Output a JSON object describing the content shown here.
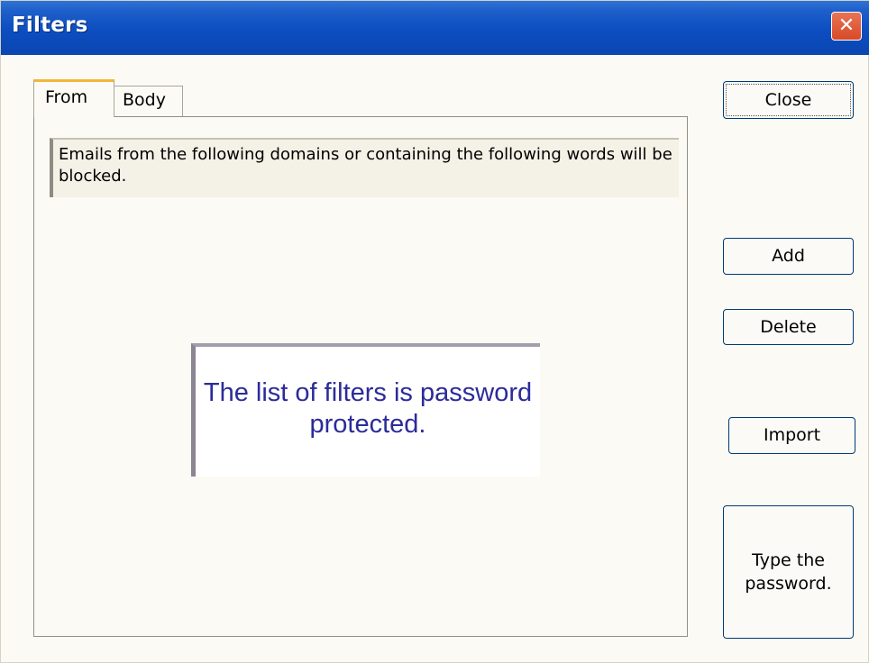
{
  "window": {
    "title": "Filters",
    "close_glyph": "✕"
  },
  "tabs": [
    {
      "label": "From",
      "active": true
    },
    {
      "label": "Body",
      "active": false
    }
  ],
  "info_text": "Emails from the following domains or containing the following words will be blocked.",
  "locked_message": "The list of filters is password protected.",
  "buttons": {
    "close": "Close",
    "add": "Add",
    "delete": "Delete",
    "import": "Import",
    "password": "Type the password."
  },
  "colors": {
    "titlebar": "#0c4dc0",
    "close_button": "#d84a26",
    "tab_highlight": "#f0b63c",
    "locked_text": "#2b2b9a"
  }
}
